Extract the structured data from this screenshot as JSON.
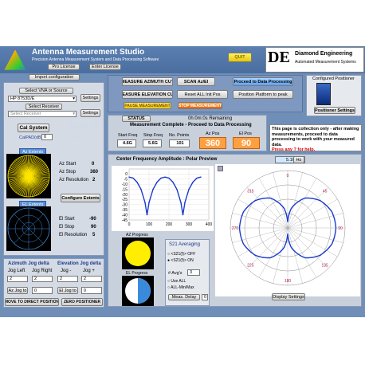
{
  "header": {
    "title": "Antenna Measurement Studio",
    "subtitle": "Precision Antenna Measurement System and Data Processing Software",
    "pro_license": "Pro License",
    "enter_license": "Enter License",
    "quit": "QUIT",
    "company": "Diamond Engineering",
    "company_sub": "Automated Measurement Systems",
    "logo_text": "DE"
  },
  "left": {
    "import_config": "Import configuration",
    "select_vna": "Select VNA or Source",
    "vna_value": "HP 8753D/E",
    "settings1": "Settings",
    "select_receiver": "Select Receiver",
    "receiver_value": "Select Receiver",
    "settings2": "Settings",
    "cal_system": "Cal System",
    "scalar": "Scalar Of",
    "cal_pad_label": "CalPAD(dB)",
    "cal_pad_value": "0",
    "pmc": "PMC&T OFF",
    "az_extents": "Az Extents",
    "az_start_label": "Az Start",
    "az_start": "0",
    "az_stop_label": "Az Stop",
    "az_stop": "360",
    "az_res_label": "Az Resolution",
    "az_res": "2",
    "configure_extents": "Configure Extents",
    "el_extents": "EL Extents",
    "el_start_label": "El Start",
    "el_start": "-90",
    "el_stop_label": "El Stop",
    "el_stop": "90",
    "el_res_label": "El Resolution",
    "el_res": "5"
  },
  "jog": {
    "az_title": "Azimuth Jog delta",
    "jog_left": "Jog Left",
    "jog_right": "Jog Right",
    "az_left_val": "2",
    "az_right_val": "2",
    "az_jog_to": "Az Jog to",
    "az_jog_val": "0",
    "el_title": "Elevation Jog delta",
    "jog_minus": "Jog -",
    "jog_plus": "Jog +",
    "el_minus_val": "2",
    "el_plus_val": "2",
    "el_jog_to": "El Jog to",
    "el_jog_val": "0",
    "move_direct": "MOVE TO DIRECT POSITION",
    "zero": "ZERO POSITIONER"
  },
  "controls": {
    "measure_az": "MEASURE AZIMUTH CUT",
    "scan_az_el": "SCAN Az/El",
    "proceed": "Proceed to Data Processing",
    "measure_el": "MEASURE ELEVATION CUT",
    "reset_init": "Reset ALL Init Pos",
    "platform_peak": "Position Platform to peak",
    "pause": "PAUSE MEASUREMENT",
    "stop": "STOP MEASUREMENT"
  },
  "positioner": {
    "title": "Configured Positioner",
    "settings": "Positioner Settings"
  },
  "status": {
    "label": "STATUS",
    "remaining": "0h:0m:0s Remaining",
    "message": "Measurement Complete - Proceed to Data Processing",
    "start_freq_label": "Start Freq",
    "start_freq": "4.6G",
    "stop_freq_label": "Stop Freq",
    "stop_freq": "5.6G",
    "npoints_label": "No. Points",
    "npoints": "101",
    "az_pos_label": "Az Pos",
    "az_pos": "360",
    "el_pos_label": "El Pos",
    "el_pos": "90"
  },
  "note": {
    "text": "This page is collection only - after making measurements, proceed to data processing to work with your measured data.",
    "help": "Press any ? for help."
  },
  "plot": {
    "title": "Center Frequency Amplitude : Polar Preview",
    "freq": "5.1G",
    "unit": "Hz",
    "display_settings": "Display Settings",
    "polar_labels": [
      "0",
      "45",
      "90",
      "135",
      "180",
      "225",
      "270",
      "315"
    ]
  },
  "chart_data": {
    "type": "line",
    "title": "",
    "ylim": [
      -45,
      5
    ],
    "xlim": [
      0,
      400
    ],
    "y_ticks": [
      "0",
      "-5",
      "-10",
      "-15",
      "-20",
      "-25",
      "-30",
      "-35",
      "-40",
      "-45"
    ],
    "x_ticks": [
      "0",
      "100",
      "200",
      "300",
      "400"
    ],
    "x": [
      0,
      20,
      40,
      60,
      80,
      90,
      100,
      120,
      140,
      160,
      180,
      200,
      220,
      240,
      260,
      270,
      280,
      300,
      320,
      340,
      360
    ],
    "values": [
      -3,
      -4,
      -8,
      -15,
      -28,
      -40,
      -28,
      -15,
      -8,
      -4,
      -3,
      -4,
      -8,
      -15,
      -28,
      -40,
      -28,
      -15,
      -8,
      -4,
      -3
    ]
  },
  "progress": {
    "az_label": "AZ Progress",
    "az_fill": 1.0,
    "el_label": "EL Progress",
    "el_fill": 0.5
  },
  "s21": {
    "title": "S21 Averaging",
    "off": "<S21(f)> OFF",
    "on": "<S21(f)> ON",
    "avg_label": "# Avg's",
    "avg_value": "3",
    "use_all": "Use ALL",
    "all_minmax": "ALL-Min/Max",
    "meas_delay": "Meas. Delay",
    "delay_value": "0"
  }
}
